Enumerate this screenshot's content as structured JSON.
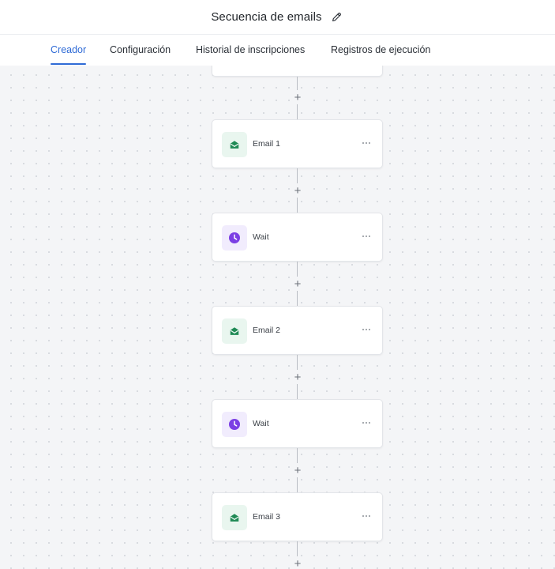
{
  "header": {
    "title": "Secuencia de emails"
  },
  "tabs": [
    {
      "label": "Creador",
      "active": true
    },
    {
      "label": "Configuración",
      "active": false
    },
    {
      "label": "Historial de inscripciones",
      "active": false
    },
    {
      "label": "Registros de ejecución",
      "active": false
    }
  ],
  "workflow": {
    "add_step_symbol": "+",
    "steps": [
      {
        "type": "email",
        "label": "Email 1",
        "icon": "envelope-open-icon"
      },
      {
        "type": "wait",
        "label": "Wait",
        "icon": "clock-icon"
      },
      {
        "type": "email",
        "label": "Email 2",
        "icon": "envelope-open-icon"
      },
      {
        "type": "wait",
        "label": "Wait",
        "icon": "clock-icon"
      },
      {
        "type": "email",
        "label": "Email 3",
        "icon": "envelope-open-icon"
      }
    ]
  },
  "colors": {
    "accent": "#2f6bd6",
    "email_icon": "#1f8a55",
    "email_icon_bg": "#e9f6ef",
    "wait_icon": "#7b3fe4",
    "wait_icon_bg": "#f1ecfd",
    "canvas_bg": "#f4f5f7"
  }
}
